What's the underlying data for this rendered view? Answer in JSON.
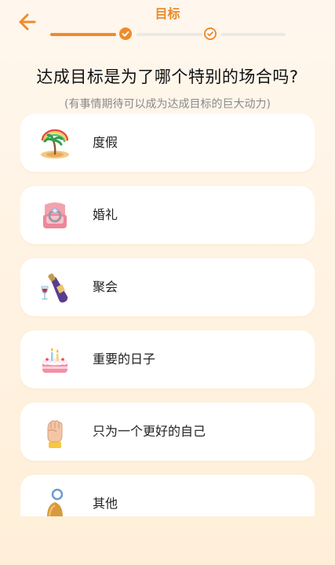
{
  "header": {
    "title": "目标",
    "back_icon": "arrow-left-icon",
    "accent_color": "#f08b2b"
  },
  "progress": {
    "total_steps": 3,
    "current_step": 2
  },
  "question": "达成目标是为了哪个特别的场合吗?",
  "subtitle": "(有事情期待可以成为达成目标的巨大动力)",
  "options": [
    {
      "label": "度假",
      "icon": "island-icon"
    },
    {
      "label": "婚礼",
      "icon": "ring-box-icon"
    },
    {
      "label": "聚会",
      "icon": "wine-bottle-icon"
    },
    {
      "label": "重要的日子",
      "icon": "birthday-cake-icon"
    },
    {
      "label": "只为一个更好的自己",
      "icon": "raised-fist-icon"
    },
    {
      "label": "其他",
      "icon": "bell-icon"
    }
  ]
}
